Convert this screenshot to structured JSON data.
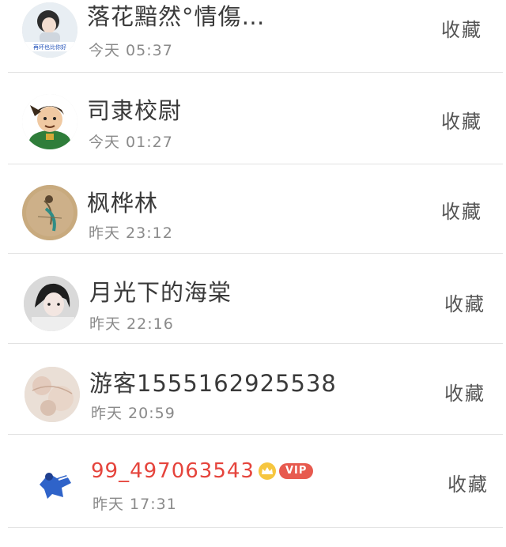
{
  "items": [
    {
      "name": "落花黯然°情傷…",
      "time": "今天 05:37",
      "action": "收藏",
      "avatar_caption": "再坏也比你好",
      "vip": false
    },
    {
      "name": "司隶校尉",
      "time": "今天 01:27",
      "action": "收藏",
      "vip": false
    },
    {
      "name": "枫桦林",
      "time": "昨天 23:12",
      "action": "收藏",
      "vip": false
    },
    {
      "name": "月光下的海棠",
      "time": "昨天 22:16",
      "action": "收藏",
      "vip": false
    },
    {
      "name": "游客1555162925538",
      "time": "昨天 20:59",
      "action": "收藏",
      "vip": false
    },
    {
      "name": "99_497063543",
      "time": "昨天 17:31",
      "action": "收藏",
      "vip": true,
      "badge": "VIP"
    }
  ],
  "colors": {
    "vip_name": "#e5443c",
    "vip_badge": "#e75a4f",
    "divider": "#e2e2e2",
    "time": "#8a8a8a"
  }
}
